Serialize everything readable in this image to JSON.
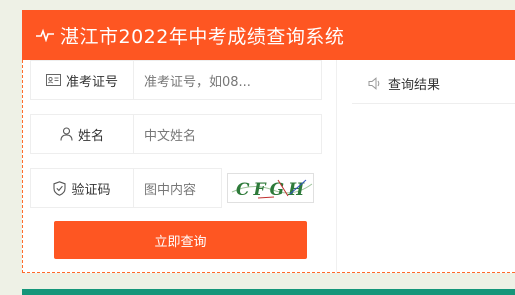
{
  "header": {
    "title": "湛江市2022年中考成绩查询系统"
  },
  "form": {
    "fields": [
      {
        "label": "准考证号",
        "placeholder": "准考证号，如08..."
      },
      {
        "label": "姓名",
        "placeholder": "中文姓名"
      },
      {
        "label": "验证码",
        "placeholder": "图中内容"
      }
    ],
    "captcha_text": "CFGH",
    "submit_label": "立即查询"
  },
  "results": {
    "title": "查询结果"
  },
  "colors": {
    "accent": "#fe5622",
    "bottom_bar": "#15967a"
  },
  "icons": [
    "pulse-icon",
    "id-card-icon",
    "user-icon",
    "shield-check-icon",
    "speaker-icon"
  ]
}
